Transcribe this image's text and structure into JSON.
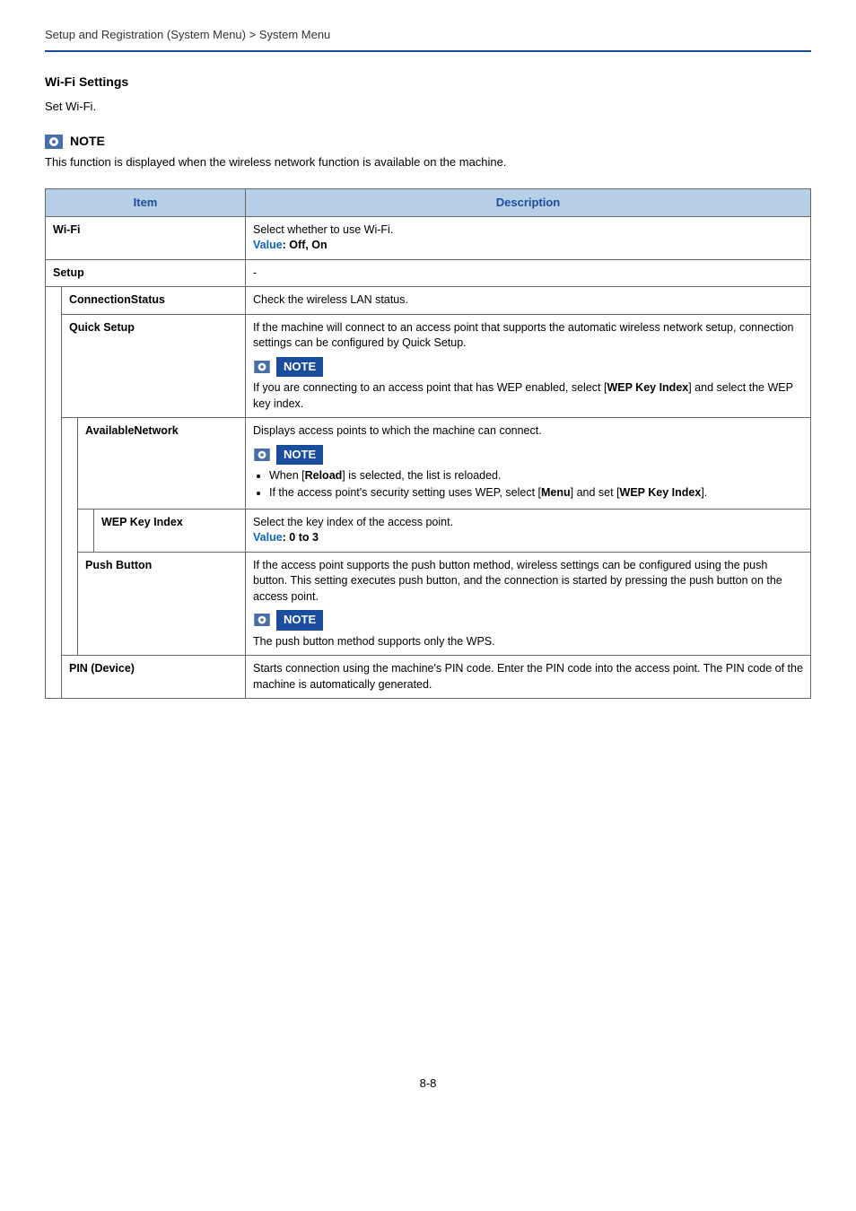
{
  "breadcrumb": "Setup and Registration (System Menu) > System Menu",
  "section_title": "Wi-Fi Settings",
  "intro": "Set Wi-Fi.",
  "top_note": {
    "label": "NOTE",
    "text": "This function is displayed when the wireless network function is available on the machine."
  },
  "table": {
    "headers": {
      "item": "Item",
      "description": "Description"
    },
    "rows": {
      "wifi": {
        "item": "Wi-Fi",
        "desc_line1": "Select whether to use Wi-Fi.",
        "value_label": "Value",
        "value_text": ": Off, On"
      },
      "setup": {
        "item": "Setup",
        "desc": "-"
      },
      "connstatus": {
        "item": "ConnectionStatus",
        "desc": "Check the wireless LAN status."
      },
      "quicksetup": {
        "item": "Quick Setup",
        "desc1": "If the machine will connect to an access point that supports the automatic wireless network setup, connection settings can be configured by Quick Setup.",
        "note_label": "NOTE",
        "note_text_pre": "If you are connecting to an access point that has WEP enabled, select [",
        "note_bold": "WEP Key Index",
        "note_text_post": "] and select the WEP key index."
      },
      "availnet": {
        "item": "AvailableNetwork",
        "desc1": "Displays access points to which the machine can connect.",
        "note_label": "NOTE",
        "bullet1_pre": "When [",
        "bullet1_bold": "Reload",
        "bullet1_post": "] is selected, the list is reloaded.",
        "bullet2_pre": "If the access point's security setting uses WEP, select [",
        "bullet2_bold1": "Menu",
        "bullet2_mid": "] and set [",
        "bullet2_bold2": "WEP Key Index",
        "bullet2_post": "]."
      },
      "wepkey": {
        "item": "WEP Key Index",
        "desc1": "Select the key index of the access point.",
        "value_label": "Value",
        "value_text": ": 0 to 3"
      },
      "pushbtn": {
        "item": "Push Button",
        "desc1": "If the access point supports the push button method, wireless settings can be configured using the push button. This setting executes push button, and the connection is started by pressing the push button on the access point.",
        "note_label": "NOTE",
        "note_text": "The push button method supports only the WPS."
      },
      "pindev": {
        "item": "PIN (Device)",
        "desc": "Starts connection using the machine's PIN code. Enter the PIN code into the access point. The PIN code of the machine is automatically generated."
      }
    }
  },
  "page_number": "8-8"
}
